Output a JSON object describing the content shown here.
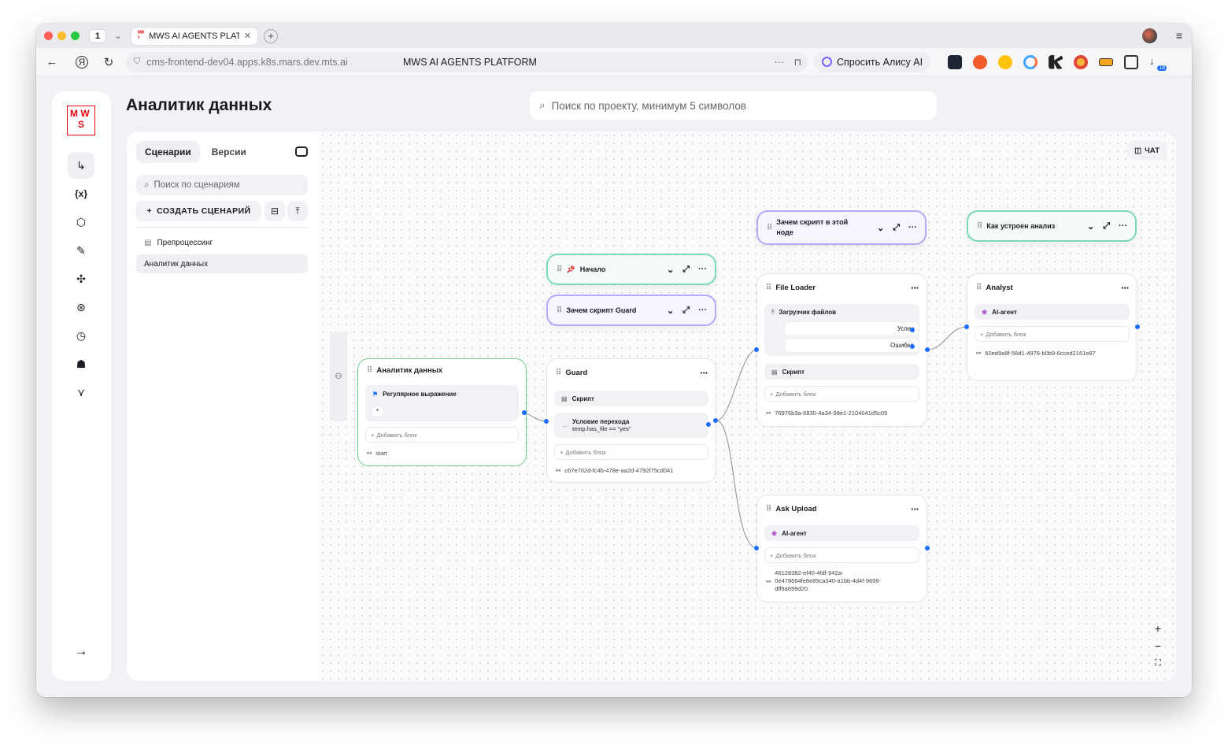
{
  "browser": {
    "tab_count": "1",
    "tab_title": "MWS AI AGENTS PLATF",
    "url": "cms-frontend-dev04.apps.k8s.mars.dev.mts.ai",
    "page_title": "MWS AI AGENTS PLATFORM",
    "alice_label": "Спросить Алису AI",
    "downloads_badge": "18"
  },
  "app": {
    "logo_text": "M W S",
    "page_title": "Аналитик данных",
    "search_placeholder": "Поиск по проекту, минимум 5 символов"
  },
  "panel": {
    "tabs": [
      "Сценарии",
      "Версии"
    ],
    "search_placeholder": "Поиск по сценариям",
    "create_label": "СОЗДАТЬ СЦЕНАРИЙ",
    "scenarios": [
      "Препроцессинг",
      "Аналитик данных"
    ]
  },
  "canvas": {
    "chat_label": "ЧАТ",
    "notes": [
      {
        "text": "Начало",
        "color": "#7ed8bc"
      },
      {
        "text": "Зачем скрипт Guard",
        "color": "#b7a9f5"
      },
      {
        "text": "Зачем скрипт в этой ноде",
        "color": "#b7a9f5"
      },
      {
        "text": "Как устроен анализ",
        "color": "#7ed8bc"
      }
    ],
    "nodes": {
      "start": {
        "title": "Аналитик данных",
        "block": "Регулярное выражение",
        "block_value": "*",
        "add": "Добавить блок",
        "id": "start"
      },
      "guard": {
        "title": "Guard",
        "block1": "Скрипт",
        "block2_title": "Условие перехода",
        "block2_expr": "temp.has_file == \"yes\"",
        "add": "Добавить блок",
        "id": "c67e702d-fc4b-478e-aa2d-4792f75cd041"
      },
      "file_loader": {
        "title": "File Loader",
        "block1": "Загрузчик файлов",
        "out1": "Успех",
        "out2": "Ошибка",
        "block2": "Скрипт",
        "add": "Добавить блок",
        "id": "76976b3a-6830-4a34-98e1-2104041d5c05"
      },
      "analyst": {
        "title": "Analyst",
        "block": "AI-агент",
        "add": "Добавить блок",
        "id": "60ed9a8f-56d1-4976-b0b9-6cced2161e87"
      },
      "ask_upload": {
        "title": "Ask Upload",
        "block": "AI-агент",
        "add": "Добавить блок",
        "id_line1": "46128382-ef40-4fdf-942a-",
        "id_line2": "0e478664fe8e89ca340-a1bb-4d4f-9699-",
        "id_line3": "dff9a699d20"
      }
    }
  },
  "colors": {
    "accent": "#1c6dff",
    "brand": "#e30611",
    "green_border": "#6bcf8a"
  }
}
